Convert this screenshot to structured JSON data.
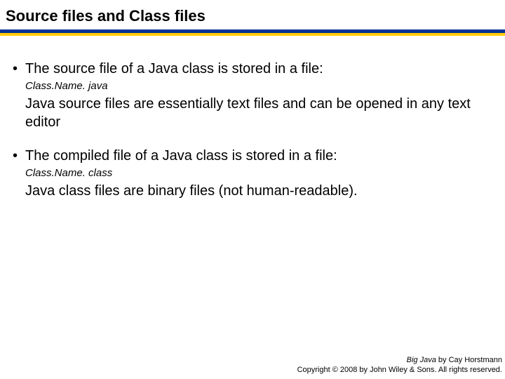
{
  "title": "Source files and Class files",
  "bullets": [
    {
      "text": "The source file of a Java class is stored in a file:",
      "code": "Class.Name. java",
      "explain": "Java source files are essentially text files and can be opened in any text editor"
    },
    {
      "text": "The compiled file of a Java class is stored in a file:",
      "code": "Class.Name. class",
      "explain": "Java class files are binary files (not human-readable)."
    }
  ],
  "footer": {
    "book": "Big Java",
    "by": " by Cay Horstmann",
    "copyright": "Copyright © 2008 by John Wiley & Sons.  All rights reserved."
  }
}
